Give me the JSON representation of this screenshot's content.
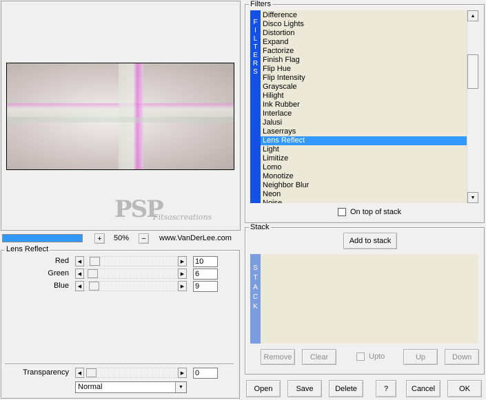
{
  "preview": {
    "watermark": "PSP",
    "watermark_sub": "Fitsascreations"
  },
  "zoom": {
    "plus_label": "+",
    "minus_label": "−",
    "value": "50%",
    "website": "www.VanDerLee.com"
  },
  "effect_group": {
    "title": "Lens Reflect",
    "params": [
      {
        "label": "Red",
        "value": "10",
        "level": 0.04
      },
      {
        "label": "Green",
        "value": "6",
        "level": 0.02
      },
      {
        "label": "Blue",
        "value": "9",
        "level": 0.035
      }
    ],
    "transparency": {
      "label": "Transparency",
      "value": "0",
      "level": 0.0
    },
    "blend_mode": "Normal"
  },
  "filters": {
    "title": "Filters",
    "side_label": "FILTERS",
    "items": [
      "Difference",
      "Disco Lights",
      "Distortion",
      "Expand",
      "Factorize",
      "Finish Flag",
      "Flip Hue",
      "Flip Intensity",
      "Grayscale",
      "Hilight",
      "Ink Rubber",
      "Interlace",
      "Jalusi",
      "Laserrays",
      "Lens Reflect",
      "Light",
      "Limitize",
      "Lomo",
      "Monotize",
      "Neighbor Blur",
      "Neon",
      "Noise"
    ],
    "selected": "Lens Reflect",
    "on_top_label": "On top of stack"
  },
  "stack": {
    "title": "Stack",
    "side_label": "STACK",
    "add_label": "Add to stack",
    "remove_label": "Remove",
    "clear_label": "Clear",
    "upto_label": "Upto",
    "up_label": "Up",
    "down_label": "Down"
  },
  "bottom_buttons": {
    "open": "Open",
    "save": "Save",
    "delete": "Delete",
    "help": "?",
    "cancel": "Cancel",
    "ok": "OK"
  },
  "colors": {
    "accent_blue": "#1452e6",
    "selection": "#3399ff",
    "list_bg": "#ece9d8",
    "stack_side": "#7b9de0"
  }
}
